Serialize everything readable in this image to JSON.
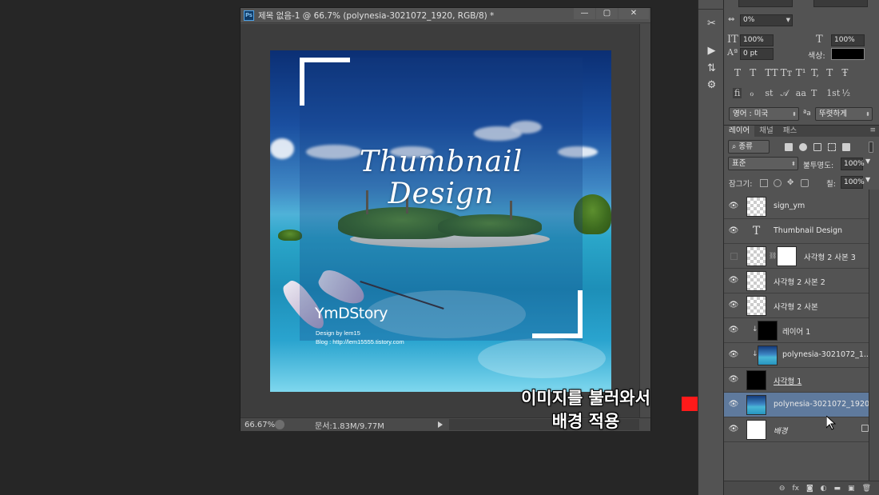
{
  "document": {
    "title": "제목 없음-1 @ 66.7% (polynesia-3021072_1920, RGB/8) *",
    "ps_badge": "Ps",
    "window_buttons": {
      "minimize": "—",
      "maximize": "▢",
      "close": "✕"
    },
    "canvas_text": {
      "title_line1": "Thumbnail",
      "title_line2": "Design",
      "signature": "YmDStory",
      "credit_line1": "Design by lem15",
      "credit_line2": "Blog : http://lem15555.tistory.com"
    },
    "status": {
      "zoom": "66.67%",
      "doc_size": "문서:1.83M/9.77M"
    }
  },
  "character_panel": {
    "tracking": "0%",
    "vertical_scale": "100%",
    "horizontal_scale": "100%",
    "baseline_shift": "0 pt",
    "color_label": "색상:",
    "text_color": "#000000",
    "language": "영어 : 미국",
    "aa_icon": "ªa",
    "antialias": "뚜렷하게",
    "style_glyphs": [
      "T",
      "T",
      "TT",
      "Tт",
      "T¹",
      "T,",
      "T",
      "Ŧ"
    ],
    "opentype_glyphs": [
      "fi",
      "ℴ",
      "st",
      "𝒜",
      "aa",
      "T",
      "1st",
      "½"
    ]
  },
  "layers_panel": {
    "tabs": [
      "레이어",
      "채널",
      "패스"
    ],
    "filter_kind": "종류",
    "blend_mode": "표준",
    "opacity_label": "불투명도:",
    "opacity": "100%",
    "lock_label": "잠그기:",
    "fill_label": "칠:",
    "fill": "100%",
    "layers": [
      {
        "name": "sign_ym",
        "thumb": "checker",
        "visible": true
      },
      {
        "name": "Thumbnail Design",
        "thumb": "text",
        "visible": true
      },
      {
        "name": "사각형 2 사본 3",
        "thumb": "checker-mask",
        "visible": false
      },
      {
        "name": "사각형 2 사본 2",
        "thumb": "checker",
        "visible": true
      },
      {
        "name": "사각형 2 사본",
        "thumb": "checker",
        "visible": true
      },
      {
        "name": "레이어 1",
        "thumb": "black",
        "visible": true,
        "clipped": true
      },
      {
        "name": "polynesia-3021072_1...",
        "thumb": "photo",
        "visible": true,
        "clipped": true
      },
      {
        "name": "사각형 1",
        "thumb": "black",
        "visible": true
      },
      {
        "name": "polynesia-3021072_1920",
        "thumb": "photo",
        "visible": true,
        "selected": true
      },
      {
        "name": "배경",
        "thumb": "white",
        "visible": true,
        "locked": true
      }
    ],
    "footer_icons": [
      "link-icon",
      "fx-icon",
      "mask-icon",
      "adjustment-icon",
      "group-icon",
      "new-layer-icon",
      "trash-icon"
    ],
    "footer_labels": [
      "⊖",
      "fx",
      "◙",
      "◐",
      "▬",
      "▣",
      "🗑"
    ]
  },
  "annotation": {
    "line1": "이미지를 불러와서",
    "line2": "배경 적용",
    "arrow_color": "#ff1a1a"
  },
  "colors": {
    "selected_layer": "#5f7a9d",
    "panel_bg": "#535353",
    "app_bg": "#262626"
  }
}
